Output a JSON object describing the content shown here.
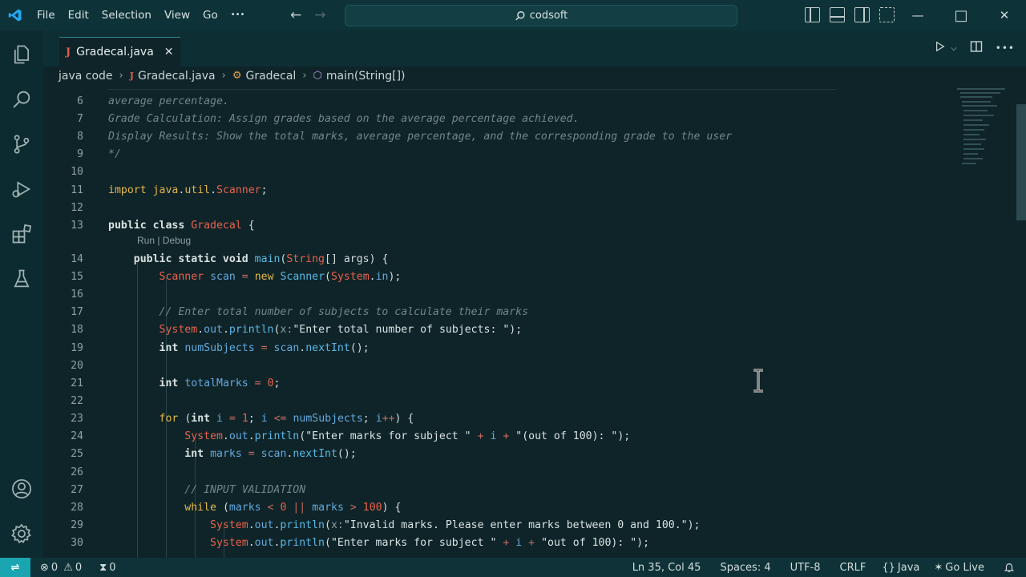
{
  "titlebar": {
    "menu": [
      "File",
      "Edit",
      "Selection",
      "View",
      "Go",
      "•••"
    ],
    "search_text": "codsoft",
    "back_arrow": "←",
    "forward_arrow": "→",
    "window_controls": {
      "minimize": "—",
      "maximize": "□",
      "close": "✕"
    }
  },
  "tab": {
    "label": "Gradecal.java",
    "close": "✕",
    "icon_letter": "J"
  },
  "breadcrumb": {
    "folder": "java code",
    "file": "Gradecal.java",
    "class": "Gradecal",
    "method": "main(String[])"
  },
  "editor": {
    "codelens": "Run | Debug",
    "lines": [
      {
        "n": "6",
        "html": "<span class='c-com'>average percentage.</span>"
      },
      {
        "n": "7",
        "html": "<span class='c-com'>Grade Calculation: Assign grades based on the average percentage achieved.</span>"
      },
      {
        "n": "8",
        "html": "<span class='c-com'>Display Results: Show the total marks, average percentage, and the corresponding grade to the user</span>"
      },
      {
        "n": "9",
        "html": "<span class='c-com'>*/</span>"
      },
      {
        "n": "10",
        "html": ""
      },
      {
        "n": "11",
        "html": "<span class='c-kw2'>import</span> <span class='c-gold'>java</span><span class='c-pl'>.</span><span class='c-gold'>util</span><span class='c-pl'>.</span><span class='c-cls'>Scanner</span><span class='c-pl'>;</span>"
      },
      {
        "n": "12",
        "html": ""
      },
      {
        "n": "13",
        "html": "<span class='c-kw'>public class</span> <span class='c-cls'>Gradecal</span> <span class='c-pl'>{</span>"
      },
      {
        "n": "14",
        "html": "    <span class='c-kw'>public static void</span> <span class='c-fn'>main</span><span class='c-pl'>(</span><span class='c-cls'>String</span><span class='c-pl'>[] args) {</span>"
      },
      {
        "n": "15",
        "html": "        <span class='c-cls'>Scanner</span> <span class='c-var'>scan</span> <span class='c-op'>=</span> <span class='c-kw2'>new</span> <span class='c-fn'>Scanner</span><span class='c-pl'>(</span><span class='c-cls'>System</span><span class='c-pl'>.</span><span class='c-var'>in</span><span class='c-pl'>);</span>"
      },
      {
        "n": "16",
        "html": ""
      },
      {
        "n": "17",
        "html": "        <span class='c-com'>// Enter total number of subjects to calculate their marks</span>"
      },
      {
        "n": "18",
        "html": "        <span class='c-cls'>System</span><span class='c-pl'>.</span><span class='c-var'>out</span><span class='c-pl'>.</span><span class='c-fn'>println</span><span class='c-pl'>(</span><span class='c-hint'>x:</span><span class='c-str'>\"Enter total number of subjects: \"</span><span class='c-pl'>);</span>"
      },
      {
        "n": "19",
        "html": "        <span class='c-kw'>int</span> <span class='c-var'>numSubjects</span> <span class='c-op'>=</span> <span class='c-var'>scan</span><span class='c-pl'>.</span><span class='c-fn'>nextInt</span><span class='c-pl'>();</span>"
      },
      {
        "n": "20",
        "html": ""
      },
      {
        "n": "21",
        "html": "        <span class='c-kw'>int</span> <span class='c-var'>totalMarks</span> <span class='c-op'>=</span> <span class='c-num'>0</span><span class='c-pl'>;</span>"
      },
      {
        "n": "22",
        "html": ""
      },
      {
        "n": "23",
        "html": "        <span class='c-kw2'>for</span> <span class='c-pl'>(</span><span class='c-kw'>int</span> <span class='c-var'>i</span> <span class='c-op'>=</span> <span class='c-num'>1</span><span class='c-pl'>; </span><span class='c-var'>i</span> <span class='c-op'>&lt;=</span> <span class='c-var'>numSubjects</span><span class='c-pl'>; </span><span class='c-var'>i</span><span class='c-op'>++</span><span class='c-pl'>) {</span>"
      },
      {
        "n": "24",
        "html": "            <span class='c-cls'>System</span><span class='c-pl'>.</span><span class='c-var'>out</span><span class='c-pl'>.</span><span class='c-fn'>println</span><span class='c-pl'>(</span><span class='c-str'>\"Enter marks for subject \"</span> <span class='c-op'>+</span> <span class='c-var'>i</span> <span class='c-op'>+</span> <span class='c-str'>\"(out of 100): \"</span><span class='c-pl'>);</span>"
      },
      {
        "n": "25",
        "html": "            <span class='c-kw'>int</span> <span class='c-var'>marks</span> <span class='c-op'>=</span> <span class='c-var'>scan</span><span class='c-pl'>.</span><span class='c-fn'>nextInt</span><span class='c-pl'>();</span>"
      },
      {
        "n": "26",
        "html": ""
      },
      {
        "n": "27",
        "html": "            <span class='c-com'>// INPUT VALIDATION</span>"
      },
      {
        "n": "28",
        "html": "            <span class='c-kw2'>while</span> <span class='c-pl'>(</span><span class='c-var'>marks</span> <span class='c-op'>&lt;</span> <span class='c-num'>0</span> <span class='c-op'>||</span> <span class='c-var'>marks</span> <span class='c-op'>&gt;</span> <span class='c-num'>100</span><span class='c-pl'>) {</span>"
      },
      {
        "n": "29",
        "html": "                <span class='c-cls'>System</span><span class='c-pl'>.</span><span class='c-var'>out</span><span class='c-pl'>.</span><span class='c-fn'>println</span><span class='c-pl'>(</span><span class='c-hint'>x:</span><span class='c-str'>\"Invalid marks. Please enter marks between 0 and 100.\"</span><span class='c-pl'>);</span>"
      },
      {
        "n": "30",
        "html": "                <span class='c-cls'>System</span><span class='c-pl'>.</span><span class='c-var'>out</span><span class='c-pl'>.</span><span class='c-fn'>println</span><span class='c-pl'>(</span><span class='c-str'>\"Enter marks for subject \"</span> <span class='c-op'>+</span> <span class='c-var'>i</span> <span class='c-op'>+</span> <span class='c-str'>\"out of 100): \"</span><span class='c-pl'>);</span>"
      }
    ]
  },
  "statusbar": {
    "errors": "0",
    "warnings": "0",
    "ports": "0",
    "position": "Ln 35, Col 45",
    "spaces": "Spaces: 4",
    "encoding": "UTF-8",
    "eol": "CRLF",
    "language": "Java",
    "golive": "Go Live"
  },
  "colors": {
    "accent": "#1aa5b0",
    "background": "#0f2428",
    "keyword": "#e5b84a",
    "class": "#e8624e",
    "function": "#59b8e6"
  }
}
